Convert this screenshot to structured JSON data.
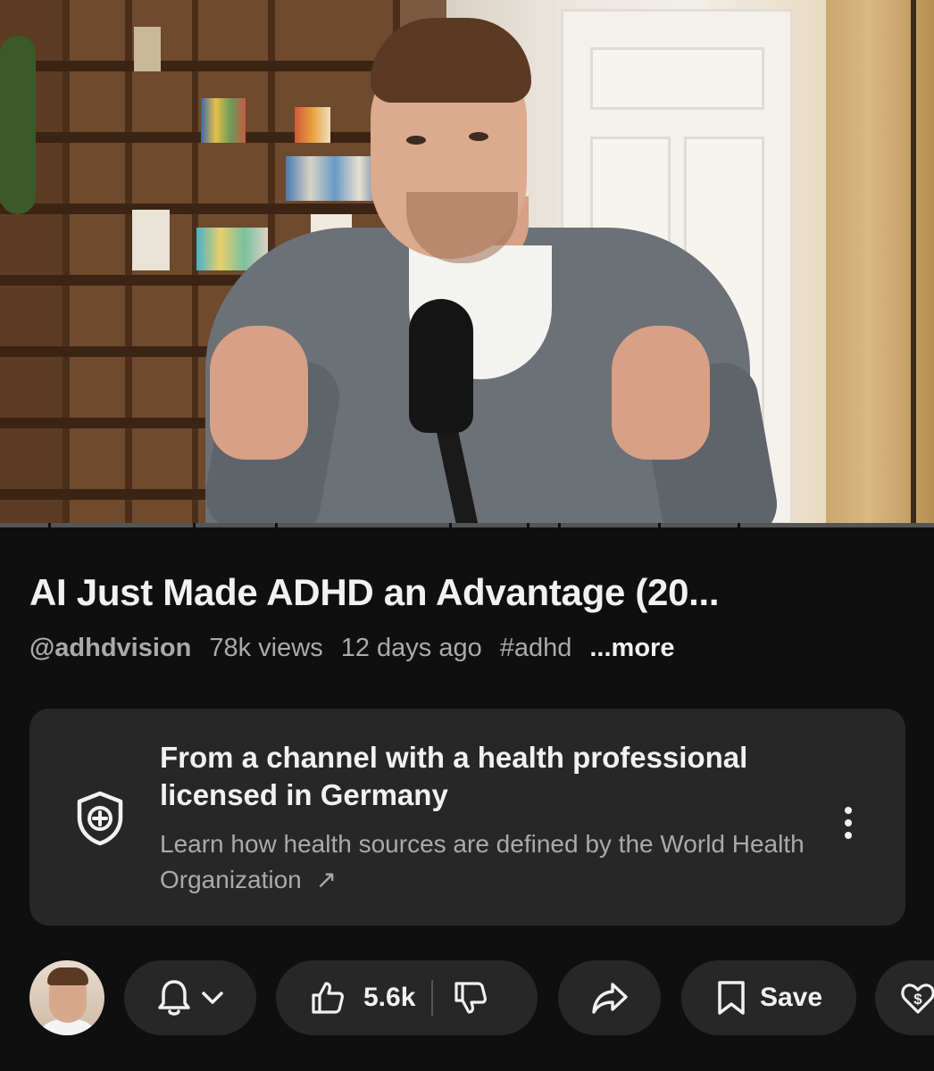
{
  "video": {
    "title": "AI Just Made ADHD an Advantage (20...",
    "channel_handle": "@adhdvision",
    "views": "78k views",
    "age": "12 days ago",
    "hashtag": "#adhd",
    "more_label": "...more"
  },
  "health_card": {
    "title": "From a channel with a health professional licensed in Germany",
    "subtitle": "Learn how health sources are defined by the World Health Organization",
    "external_link_glyph": "↗",
    "icon": "medical-shield-icon"
  },
  "actions": {
    "like_count": "5.6k",
    "save_label": "Save",
    "icons": [
      "bell-icon",
      "chevron-down-icon",
      "thumbs-up-icon",
      "thumbs-down-icon",
      "share-icon",
      "save-bookmark-icon",
      "thanks-heart-dollar-icon"
    ]
  },
  "colors": {
    "background": "#0f0f0f",
    "card": "#272727",
    "text_primary": "#f1f1f1",
    "text_secondary": "#aaaaaa"
  }
}
